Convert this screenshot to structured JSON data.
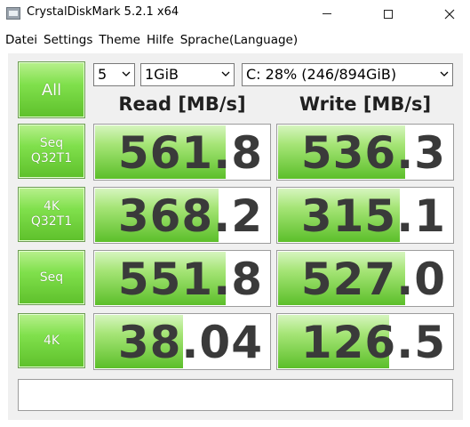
{
  "window": {
    "title": "CrystalDiskMark 5.2.1 x64"
  },
  "menu": [
    "Datei",
    "Settings",
    "Theme",
    "Hilfe",
    "Sprache(Language)"
  ],
  "controls": {
    "all_label": "All",
    "count": "5",
    "size": "1GiB",
    "drive": "C: 28% (246/894GiB)"
  },
  "headers": {
    "read": "Read [MB/s]",
    "write": "Write [MB/s]"
  },
  "rows": [
    {
      "label_1": "Seq",
      "label_2": "Q32T1",
      "read": "561.8",
      "write": "536.3",
      "read_level": 0.74,
      "write_level": 0.72
    },
    {
      "label_1": "4K",
      "label_2": "Q32T1",
      "read": "368.2",
      "write": "315.1",
      "read_level": 0.7,
      "write_level": 0.69
    },
    {
      "label_1": "Seq",
      "label_2": "",
      "read": "551.8",
      "write": "527.0",
      "read_level": 0.74,
      "write_level": 0.72
    },
    {
      "label_1": "4K",
      "label_2": "",
      "read": "38.04",
      "write": "126.5",
      "read_level": 0.5,
      "write_level": 0.63
    }
  ],
  "comment": "",
  "colors": {
    "accent_green": "#5ec02b",
    "button_border": "#6e9c55"
  }
}
